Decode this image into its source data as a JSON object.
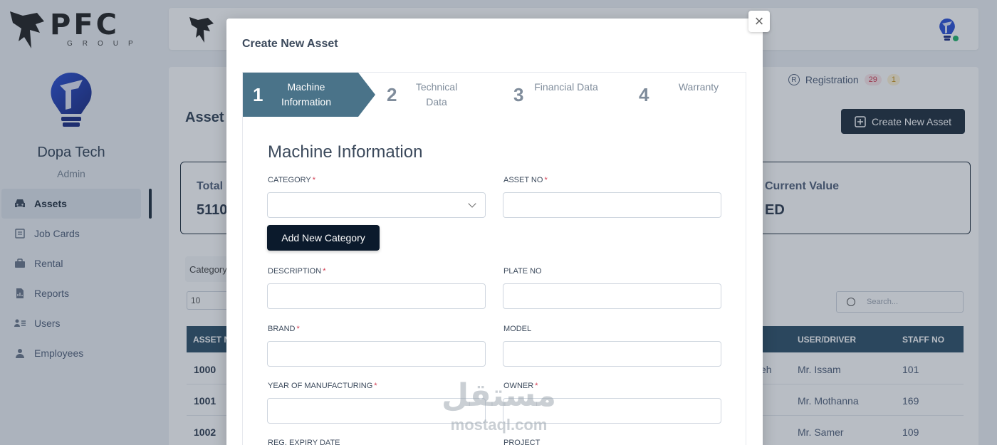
{
  "brand": {
    "logo_main": "PFC",
    "logo_sub": "GROUP"
  },
  "sidebar": {
    "user_name": "Dopa Tech",
    "user_role": "Admin",
    "items": [
      {
        "label": "Assets",
        "icon": "car-icon"
      },
      {
        "label": "Job Cards",
        "icon": "clipboard-icon"
      },
      {
        "label": "Rental",
        "icon": "briefcase-icon"
      },
      {
        "label": "Reports",
        "icon": "file-chart-icon"
      },
      {
        "label": "Users",
        "icon": "users-list-icon"
      },
      {
        "label": "Employees",
        "icon": "person-icon"
      }
    ]
  },
  "header": {
    "tab_label": "Registration",
    "badge_red": "29",
    "badge_yellow": "1"
  },
  "page": {
    "title": "Asset",
    "create_button": "Create New Asset",
    "stat_total_label": "Total",
    "stat_total_value": "5110",
    "stat_current_label": "Current Value",
    "stat_current_value": "ED",
    "filter_category": "Category",
    "page_size": "10",
    "search_placeholder": "Search..."
  },
  "table": {
    "columns": [
      "ASSET N",
      "USER/DRIVER",
      "STAFF NO"
    ],
    "rows": [
      {
        "asset_no": "1000",
        "partial": "eh",
        "driver": "Mr. Issam",
        "staff_no": "101"
      },
      {
        "asset_no": "1001",
        "partial": "",
        "driver": "Mr. Mothanna",
        "staff_no": "169"
      },
      {
        "asset_no": "1002",
        "partial": "",
        "driver": "Mr. Samer",
        "staff_no": "109"
      }
    ]
  },
  "modal": {
    "title": "Create New Asset",
    "close": "×",
    "steps": [
      {
        "num": "1",
        "label": "Machine Information"
      },
      {
        "num": "2",
        "label": "Technical Data"
      },
      {
        "num": "3",
        "label": "Financial Data"
      },
      {
        "num": "4",
        "label": "Warranty"
      }
    ],
    "section_title": "Machine Information",
    "add_category_button": "Add New Category",
    "fields": {
      "category": "CATEGORY",
      "asset_no": "ASSET NO",
      "description": "DESCRIPTION",
      "plate_no": "PLATE NO",
      "brand": "BRAND",
      "model": "MODEL",
      "year": "YEAR OF MANUFACTURING",
      "owner": "OWNER",
      "reg_expiry": "REG. EXPIRY DATE",
      "project": "PROJECT"
    },
    "required_mark": "*"
  },
  "watermark": {
    "arabic": "مستقل",
    "latin": "mostaql.com"
  },
  "colors": {
    "primary": "#1f2d3d",
    "step_active": "#4a7389",
    "table_header": "#2d4f68",
    "required": "#d23b50"
  }
}
